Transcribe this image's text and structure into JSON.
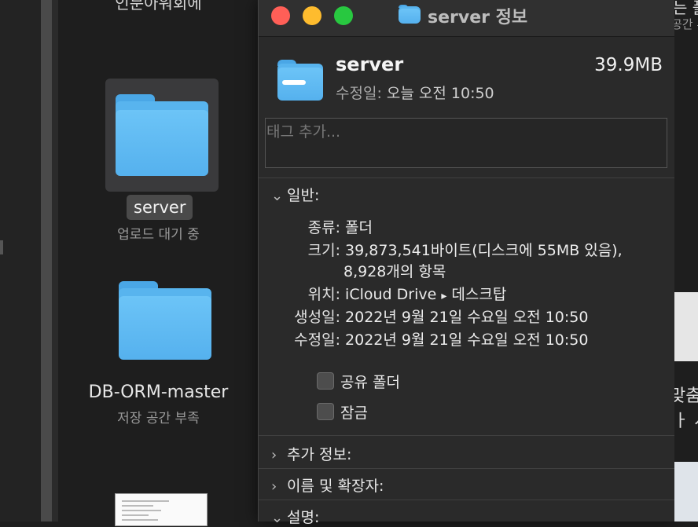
{
  "desktop": {
    "top_label": "인문아워회에",
    "items": [
      {
        "name": "server",
        "status": "업로드 대기 중"
      },
      {
        "name": "DB-ORM-master",
        "status": "저장 공간 부족"
      }
    ]
  },
  "info_window": {
    "title": "server 정보",
    "name": "server",
    "size": "39.9MB",
    "modified_key": "수정일:",
    "modified_value": "오늘 오전 10:50",
    "tag_placeholder": "태그 추가...",
    "sections": {
      "general": "일반:",
      "more_info": "추가 정보:",
      "name_ext": "이름 및 확장자:",
      "comments": "설명:"
    },
    "general": {
      "kind_key": "종류:",
      "kind_value": "폴더",
      "size_key": "크기:",
      "size_value": "39,873,541바이트(디스크에 55MB 있음),",
      "size_items": "8,928개의 항목",
      "where_key": "위치:",
      "where_value_prefix": "iCloud Drive",
      "where_arrow": "▸",
      "where_value_suffix": "데스크탑",
      "created_key": "생성일:",
      "created_value": "2022년 9월 21일 수요일 오전 10:50",
      "modified_key": "수정일:",
      "modified_value": "2022년 9월 21일 수요일 오전 10:50"
    },
    "checkboxes": {
      "shared": "공유 폴더",
      "locked": "잠금"
    },
    "chevrons": {
      "open": "⌄",
      "closed": "›"
    }
  },
  "right_edge": {
    "t1": "는 폴",
    "t2": "공간 부",
    "t3": "맞춤",
    "t4": "ㅏ 시"
  },
  "colors": {
    "close": "#ff5f57",
    "minimize": "#febc2e",
    "zoom": "#28c840",
    "folder": "#58b4ee"
  }
}
